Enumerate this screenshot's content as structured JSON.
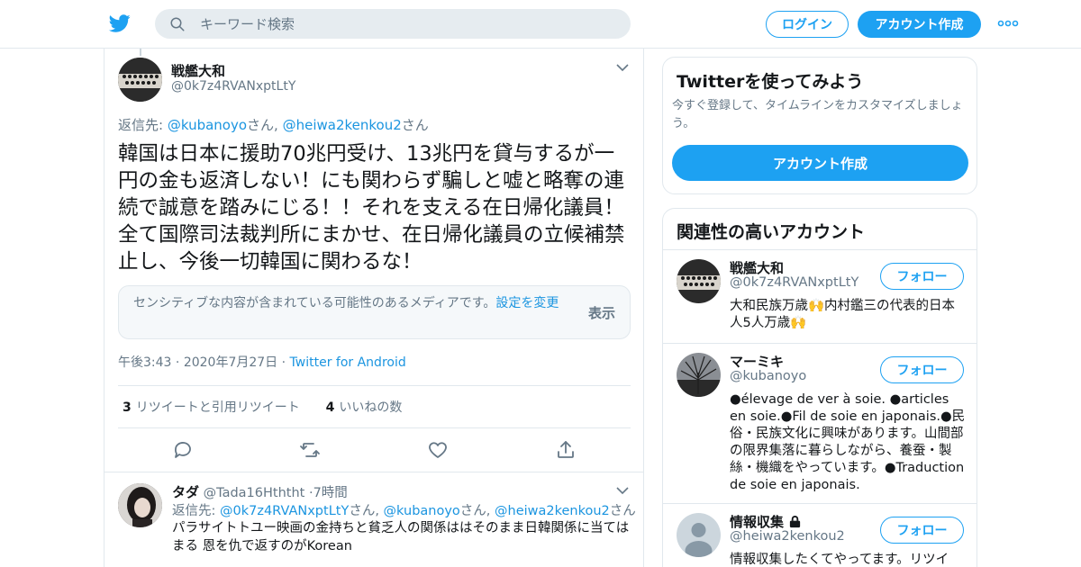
{
  "header": {
    "search_placeholder": "キーワード検索",
    "login_label": "ログイン",
    "signup_label": "アカウント作成",
    "brand_color": "#1da1f2"
  },
  "tweet": {
    "author_name": "戦艦大和",
    "author_handle": "@0k7z4RVANxptLtY",
    "reply_prefix": "返信先:",
    "reply_to": [
      {
        "handle": "@kubanoyo",
        "suffix": "さん,"
      },
      {
        "handle": "@heiwa2kenkou2",
        "suffix": "さん"
      }
    ],
    "text": "韓国は日本に援助70兆円受け、13兆円を貸与するが一円の金も返済しない！にも関わらず騙しと嘘と略奪の連続で誠意を踏みにじる！！それを支える在日帰化議員！全て国際司法裁判所にまかせ、在日帰化議員の立候補禁止し、今後一切韓国に関わるな！",
    "sensitive_notice": "センシティブな内容が含まれている可能性のあるメディアです。",
    "sensitive_link": "設定を変更",
    "sensitive_show": "表示",
    "time": "午後3:43",
    "date": "2020年7月27日",
    "source": "Twitter for Android",
    "retweet_count": "3",
    "retweet_label": "リツイートと引用リツイート",
    "like_count": "4",
    "like_label": "いいねの数"
  },
  "reply": {
    "author_name": "タダ",
    "author_handle": "@Tada16Hththt",
    "time_ago": "7時間",
    "reply_prefix": "返信先:",
    "reply_to": [
      {
        "handle": "@0k7z4RVANxptLtY",
        "suffix": "さん,"
      },
      {
        "handle": "@kubanoyo",
        "suffix": "さん,"
      },
      {
        "handle": "@heiwa2kenkou2",
        "suffix": "さん"
      }
    ],
    "text": "パラサイトトユー映画の金持ちと貧乏人の関係ははそのまま日韓関係に当てはまる 恩を仇で返すのがKorean"
  },
  "sidebar": {
    "promo": {
      "title": "Twitterを使ってみよう",
      "description": "今すぐ登録して、タイムラインをカスタマイズしましょう。",
      "button": "アカウント作成"
    },
    "related": {
      "title": "関連性の高いアカウント",
      "follow_label": "フォロー",
      "accounts": [
        {
          "name": "戦艦大和",
          "handle": "@0k7z4RVANxptLtY",
          "bio": "大和民族万歳🙌内村鑑三の代表的日本人5人万歳🙌"
        },
        {
          "name": "マーミキ",
          "handle": "@kubanoyo",
          "bio": "●élevage de ver à soie. ●articles en soie.●Fil de soie en japonais.●民俗・民族文化に興味があります。山間部の限界集落に暮らしながら、養蚕・製絲・機織をやっています。●Traduction de soie en japonais."
        },
        {
          "name": "情報収集",
          "handle": "@heiwa2kenkou2",
          "bio": "情報収集したくてやってます。リツイ"
        }
      ]
    }
  }
}
